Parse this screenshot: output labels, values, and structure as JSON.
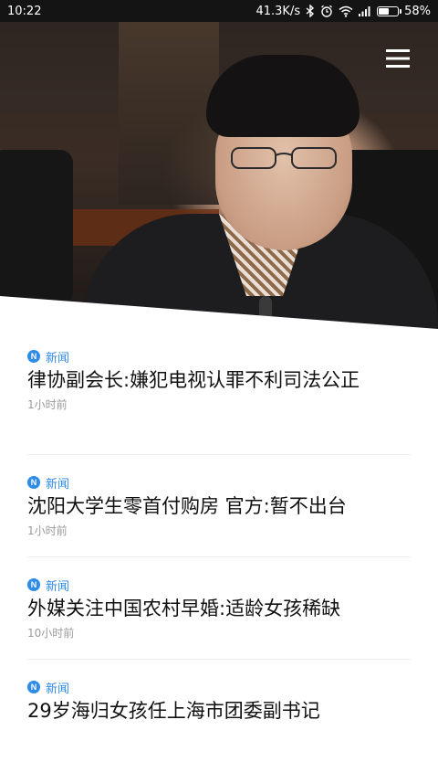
{
  "status_bar": {
    "time": "10:22",
    "network_speed": "41.3K/s",
    "battery_percent": "58%",
    "battery_level": 0.58,
    "icons": [
      "bluetooth-icon",
      "alarm-icon",
      "wifi-icon",
      "signal-icon",
      "battery-icon"
    ]
  },
  "hero": {
    "image_desc_icon": "photo"
  },
  "menu": {
    "icon": "hamburger-menu-icon"
  },
  "news": [
    {
      "category": "新闻",
      "category_icon": "N",
      "title": "律协副会长:嫌犯电视认罪不利司法公正",
      "time": "1小时前"
    },
    {
      "category": "新闻",
      "category_icon": "N",
      "title": "沈阳大学生零首付购房 官方:暂不出台",
      "time": "1小时前"
    },
    {
      "category": "新闻",
      "category_icon": "N",
      "title": "外媒关注中国农村早婚:适龄女孩稀缺",
      "time": "10小时前"
    },
    {
      "category": "新闻",
      "category_icon": "N",
      "title": "29岁海归女孩任上海市团委副书记",
      "time": ""
    }
  ],
  "colors": {
    "accent": "#2e8be6",
    "status_bar_bg": "#141414",
    "title_text": "#111111",
    "time_text": "#9a9a9a"
  }
}
